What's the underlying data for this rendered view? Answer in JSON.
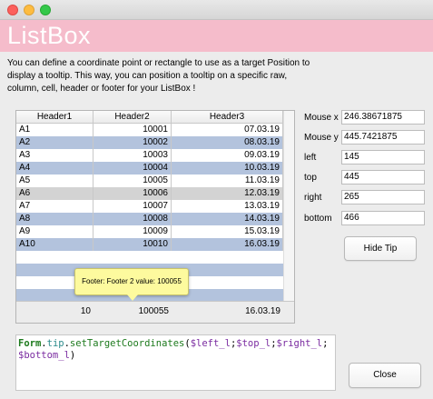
{
  "window": {
    "title": ""
  },
  "banner": {
    "title": "ListBox"
  },
  "description": "You can define a coordinate point or rectangle to use as a target Position to display a tooltip. This way, you can position a tooltip on a specific raw, column, cell, header or footer for your ListBox !",
  "listbox": {
    "headers": [
      "Header1",
      "Header2",
      "Header3"
    ],
    "rows": [
      [
        "A1",
        "10001",
        "07.03.19"
      ],
      [
        "A2",
        "10002",
        "08.03.19"
      ],
      [
        "A3",
        "10003",
        "09.03.19"
      ],
      [
        "A4",
        "10004",
        "10.03.19"
      ],
      [
        "A5",
        "10005",
        "11.03.19"
      ],
      [
        "A6",
        "10006",
        "12.03.19"
      ],
      [
        "A7",
        "10007",
        "13.03.19"
      ],
      [
        "A8",
        "10008",
        "14.03.19"
      ],
      [
        "A9",
        "10009",
        "15.03.19"
      ],
      [
        "A10",
        "10010",
        "16.03.19"
      ]
    ],
    "footer": [
      "10",
      "100055",
      "16.03.19"
    ]
  },
  "tooltip": {
    "text": "Footer: Footer 2 value: 100055"
  },
  "fields": {
    "mouse_x": {
      "label": "Mouse x",
      "value": "246.38671875"
    },
    "mouse_y": {
      "label": "Mouse y",
      "value": "445.7421875"
    },
    "left": {
      "label": "left",
      "value": "145"
    },
    "top": {
      "label": "top",
      "value": "445"
    },
    "right": {
      "label": "right",
      "value": "265"
    },
    "bottom": {
      "label": "bottom",
      "value": "466"
    }
  },
  "buttons": {
    "hide_tip": "Hide Tip",
    "close": "Close"
  },
  "code": {
    "form": "Form",
    "dot1": ".",
    "tip": "tip",
    "dot2": ".",
    "fn": "setTargetCoordinates",
    "open": "(",
    "v1": "$left_l",
    "s1": ";",
    "v2": "$top_l",
    "s2": ";",
    "v3": "$right_l",
    "s3": ";",
    "v4": "$bottom_l",
    "close": ")"
  },
  "colors": {
    "banner": "#f5bccb",
    "alt_row": "#b3c3dd",
    "selected_row": "#d3d3d3",
    "tooltip_bg": "#fdfa9e"
  }
}
